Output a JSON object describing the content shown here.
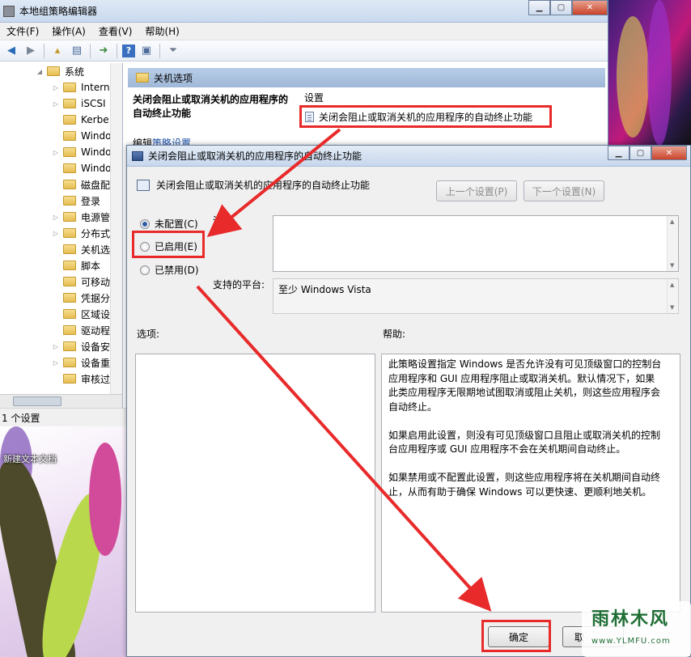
{
  "main_window": {
    "title": "本地组策略编辑器",
    "menu": [
      "文件(F)",
      "操作(A)",
      "查看(V)",
      "帮助(H)"
    ],
    "tree_items": [
      "系统",
      "Intern",
      "iSCSI",
      "Kerbe",
      "Windo",
      "Windo",
      "Windo",
      "磁盘配",
      "登录",
      "电源管",
      "分布式",
      "关机选",
      "脚本",
      "可移动",
      "凭据分",
      "区域设",
      "驱动程",
      "设备安",
      "设备重",
      "审核过"
    ],
    "status": "1 个设置"
  },
  "policy_pane": {
    "header": "关机选项",
    "description": "关闭会阻止或取消关机的应用程序的自动终止功能",
    "edit_link_prefix": "编辑",
    "edit_link": "策略设置",
    "column_header": "设置",
    "selected_setting": "关闭会阻止或取消关机的应用程序的自动终止功能"
  },
  "desktop": {
    "icon_label": "新建文本文档"
  },
  "dialog": {
    "title": "关闭会阻止或取消关机的应用程序的自动终止功能",
    "policy_name": "关闭会阻止或取消关机的应用程序的自动终止功能",
    "prev_button": "上一个设置(P)",
    "next_button": "下一个设置(N)",
    "radio_not_configured": "未配置(C)",
    "radio_enabled": "已启用(E)",
    "radio_disabled": "已禁用(D)",
    "selected_option": "not_configured",
    "comment_label": "注释:",
    "supported_label": "支持的平台:",
    "supported_value": "至少 Windows Vista",
    "options_label": "选项:",
    "help_label": "帮助:",
    "help_text": "此策略设置指定 Windows 是否允许没有可见顶级窗口的控制台应用程序和 GUI 应用程序阻止或取消关机。默认情况下，如果此类应用程序无限期地试图取消或阻止关机，则这些应用程序会自动终止。\n\n如果启用此设置，则没有可见顶级窗口且阻止或取消关机的控制台应用程序或 GUI 应用程序不会在关机期间自动终止。\n\n如果禁用或不配置此设置，则这些应用程序将在关机期间自动终止，从而有助于确保 Windows 可以更快速、更顺利地关机。",
    "ok_button": "确定",
    "cancel_button": "取"
  },
  "watermark": {
    "text": "雨林木风",
    "url": "www.YLMFU.com"
  },
  "colors": {
    "highlight_red": "#e82a2a",
    "titlebar": "#c9d9ee",
    "header_blue": "#9fb8d8"
  }
}
